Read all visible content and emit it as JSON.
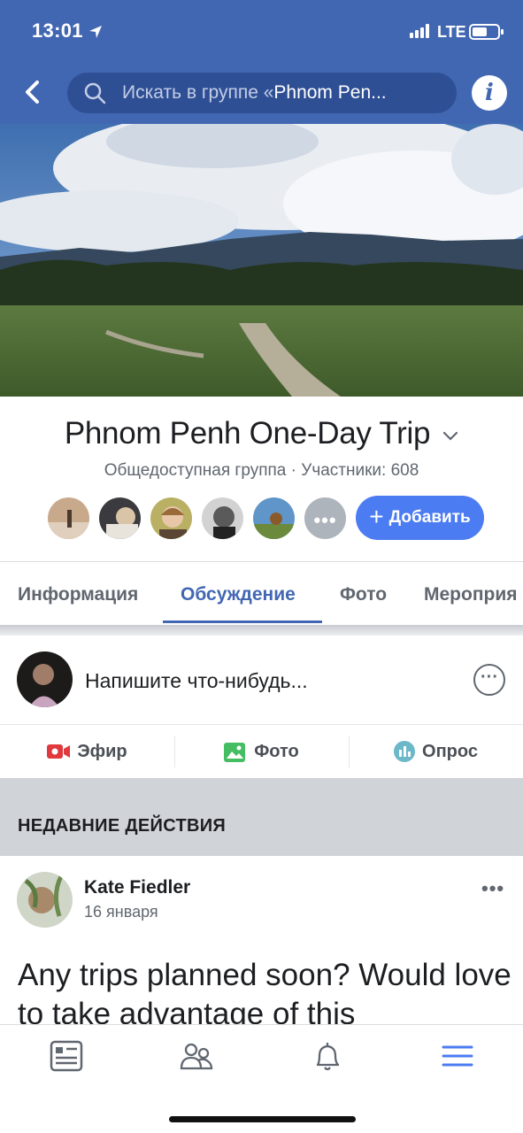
{
  "status_bar": {
    "time": "13:01",
    "network": "LTE"
  },
  "header": {
    "search_placeholder_prefix": "Искать в группе «",
    "search_placeholder_group": "Phnom Pen..."
  },
  "group": {
    "name": "Phnom Penh One-Day Trip",
    "privacy": "Общедоступная группа",
    "members_label": "Участники: 608",
    "add_button": "Добавить"
  },
  "tabs": [
    "Информация",
    "Обсуждение",
    "Фото",
    "Мероприя"
  ],
  "active_tab": "Обсуждение",
  "composer": {
    "placeholder": "Напишите что-нибудь..."
  },
  "actions": {
    "live": "Эфир",
    "photo": "Фото",
    "poll": "Опрос"
  },
  "recent": {
    "title": "НЕДАВНИЕ ДЕЙСТВИЯ"
  },
  "post": {
    "author": "Kate Fiedler",
    "date": "16 января",
    "text": "Any trips planned soon? Would love to take advantage of this"
  },
  "icons": {
    "back": "chevron-left-icon",
    "search": "search-icon",
    "info": "info-icon",
    "more": "more-horizontal-icon",
    "nav": [
      "news-feed-icon",
      "groups-icon",
      "notifications-bell-icon",
      "menu-icon"
    ]
  },
  "colors": {
    "brand": "#4267b2",
    "accent_button": "#4c7cf2",
    "live": "#e0393e",
    "photo": "#45bd62",
    "poll": "#6cb8c9"
  }
}
